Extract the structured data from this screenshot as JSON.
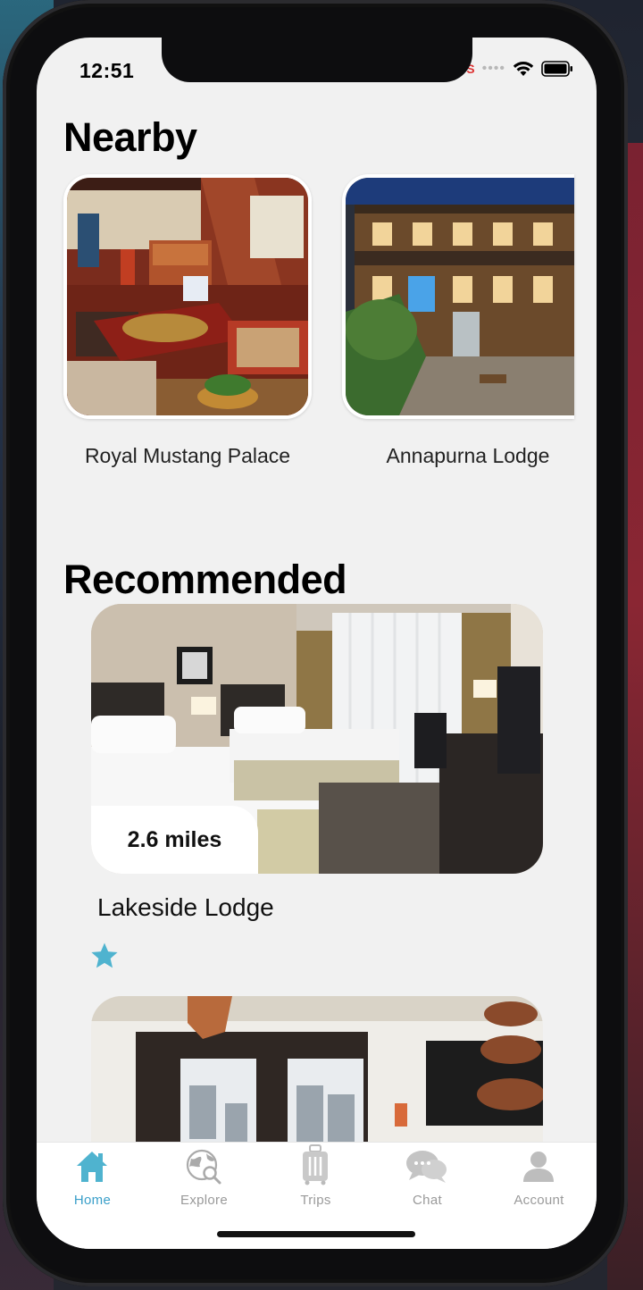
{
  "status": {
    "time": "12:51",
    "carrier": "S"
  },
  "nearby": {
    "title": "Nearby",
    "items": [
      {
        "name": "Royal Mustang Palace"
      },
      {
        "name": "Annapurna Lodge"
      }
    ]
  },
  "recommended": {
    "title": "Recommended",
    "items": [
      {
        "name": "Lakeside Lodge",
        "distance": "2.6 miles",
        "rating_stars": 1
      }
    ]
  },
  "tabs": [
    {
      "label": "Home",
      "icon": "home-icon",
      "active": true
    },
    {
      "label": "Explore",
      "icon": "globe-search-icon",
      "active": false
    },
    {
      "label": "Trips",
      "icon": "luggage-icon",
      "active": false
    },
    {
      "label": "Chat",
      "icon": "chat-bubbles-icon",
      "active": false
    },
    {
      "label": "Account",
      "icon": "user-icon",
      "active": false
    }
  ],
  "colors": {
    "accent": "#3a9fc9",
    "star": "#4fb3cf",
    "inactive_tab": "#9a9a9a",
    "background": "#f1f1f1"
  }
}
